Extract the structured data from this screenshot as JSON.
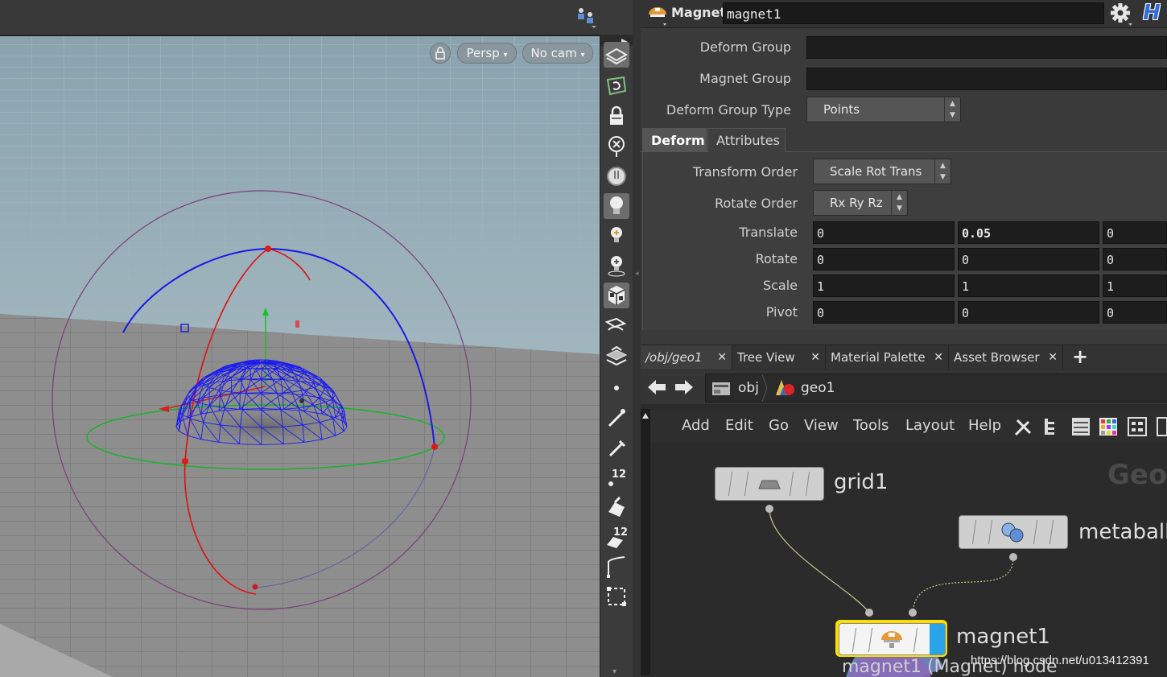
{
  "viewport": {
    "persp_label": "Persp",
    "nocam_label": "No cam",
    "help_glyph": "?",
    "lock_icon": "lock-icon",
    "display_icon": "display-options-icon",
    "ground_color": "#8e8e8e",
    "sky_color": "#8fa8b4"
  },
  "shelf": {
    "tools": [
      "select-icon",
      "view-icon",
      "lock-icon",
      "snap-icon",
      "camera-icon",
      "light-bulb-icon",
      "add-light-icon",
      "add-light-2-icon",
      "shaded-cube-icon",
      "render-icon",
      "render-region-icon",
      "point-icon",
      "paint-icon",
      "pen-icon",
      "twelve-a-icon",
      "brush-icon",
      "twelve-b-icon",
      "curve-icon",
      "grid-select-icon"
    ],
    "number_a": "12",
    "number_b": "12"
  },
  "param_pane": {
    "node_type": "Magnet",
    "node_name": "magnet1",
    "gear_icon": "gear-icon",
    "houdini_logo": "H",
    "deform_group_label": "Deform Group",
    "deform_group_value": "",
    "magnet_group_label": "Magnet Group",
    "magnet_group_value": "",
    "deform_group_type_label": "Deform Group Type",
    "deform_group_type_value": "Points",
    "tabs": [
      "Deform",
      "Attributes"
    ],
    "transform_order_label": "Transform Order",
    "transform_order_value": "Scale Rot Trans",
    "rotate_order_label": "Rotate Order",
    "rotate_order_value": "Rx Ry Rz",
    "translate_label": "Translate",
    "translate": [
      "0",
      "0.05",
      "0"
    ],
    "rotate_label": "Rotate",
    "rotate": [
      "0",
      "0",
      "0"
    ],
    "scale_label": "Scale",
    "scale": [
      "1",
      "1",
      "1"
    ],
    "pivot_label": "Pivot",
    "pivot": [
      "0",
      "0",
      "0"
    ]
  },
  "network_pane": {
    "tabs": [
      "/obj/geo1",
      "Tree View",
      "Material Palette",
      "Asset Browser"
    ],
    "add_tab": "+",
    "path": [
      "obj",
      "geo1"
    ],
    "menu": [
      "Add",
      "Edit",
      "Go",
      "View",
      "Tools",
      "Layout",
      "Help"
    ],
    "watermark_context": "Geor",
    "nodes": {
      "grid": "grid1",
      "metaball": "metaball",
      "magnet": "magnet1"
    },
    "selected_caption": "magnet1 (Magnet) node",
    "url_watermark": "https://blog.csdn.net/u013412391",
    "node_colors": {
      "highlight": "#ffdd00",
      "blue_flag": "#2aa4e8",
      "metaball_halo": "#6a7fb5"
    }
  }
}
